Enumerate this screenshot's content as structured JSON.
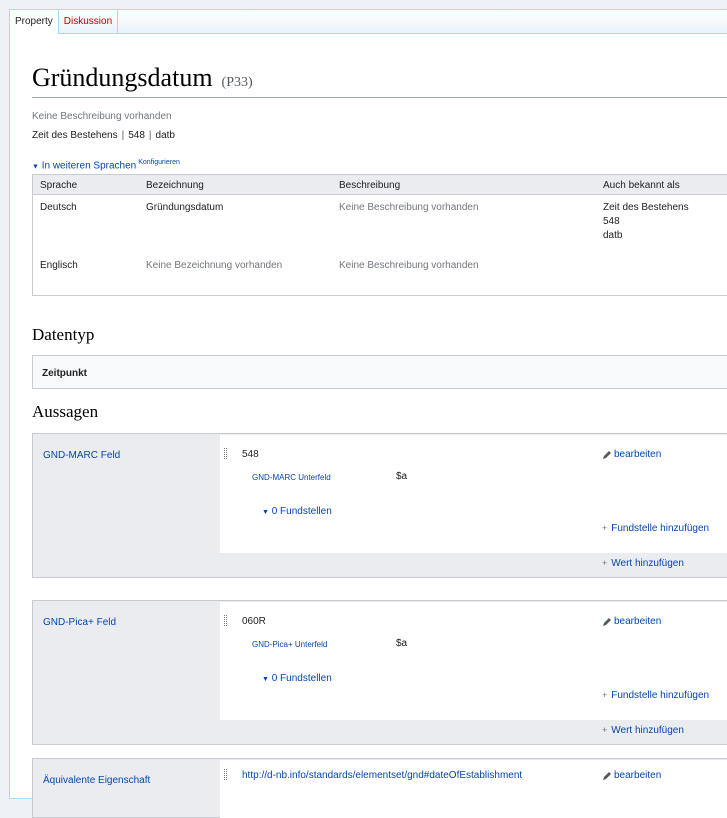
{
  "tabs": {
    "property": "Property",
    "discussion": "Diskussion"
  },
  "title": {
    "label": "Gründungsdatum",
    "id": "(P33)"
  },
  "description": "Keine Beschreibung vorhanden",
  "aliases": [
    "Zeit des Bestehens",
    "548",
    "datb"
  ],
  "languages": {
    "toggle": "In weiteren Sprachen",
    "configure": "Konfigurieren",
    "headers": [
      "Sprache",
      "Bezeichnung",
      "Beschreibung",
      "Auch bekannt als"
    ],
    "rows": [
      {
        "language": "Deutsch",
        "label": "Gründungsdatum",
        "description": "Keine Beschreibung vorhanden",
        "aliases": [
          "Zeit des Bestehens",
          "548",
          "datb"
        ]
      },
      {
        "language": "Englisch",
        "label": "Keine Bezeichnung vorhanden",
        "description": "Keine Beschreibung vorhanden",
        "aliases": []
      }
    ]
  },
  "datatype": {
    "heading": "Datentyp",
    "value": "Zeitpunkt"
  },
  "statements": {
    "heading": "Aussagen",
    "edit_label": "bearbeiten",
    "add_reference": "Fundstelle hinzufügen",
    "add_value": "Wert hinzufügen",
    "items": [
      {
        "property": "GND-MARC Feld",
        "value": "548",
        "qualifier_property": "GND-MARC Unterfeld",
        "qualifier_value": "$a",
        "references": "0 Fundstellen"
      },
      {
        "property": "GND-Pica+ Feld",
        "value": "060R",
        "qualifier_property": "GND-Pica+ Unterfeld",
        "qualifier_value": "$a",
        "references": "0 Fundstellen"
      },
      {
        "property": "Äquivalente Eigenschaft",
        "value": "http://d-nb.info/standards/elementset/gnd#dateOfEstablishment"
      }
    ]
  },
  "colors": {
    "link": "#0645ad",
    "red_link": "#ba0000",
    "muted": "#72777d",
    "border": "#c8ccd1"
  }
}
